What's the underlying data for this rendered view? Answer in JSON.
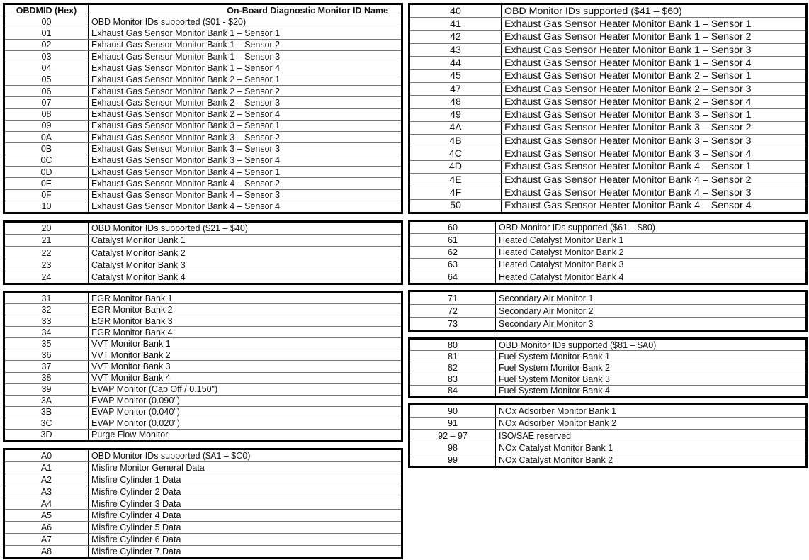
{
  "header": {
    "id_col": "OBDMID (Hex)",
    "name_col": "On-Board Diagnostic Monitor ID Name"
  },
  "tables": [
    {
      "rows": [
        [
          "00",
          "OBD Monitor IDs supported ($01 - $20)"
        ],
        [
          "01",
          "Exhaust Gas Sensor Monitor Bank 1 – Sensor 1"
        ],
        [
          "02",
          "Exhaust Gas Sensor Monitor Bank 1 – Sensor 2"
        ],
        [
          "03",
          "Exhaust Gas Sensor Monitor Bank 1 – Sensor 3"
        ],
        [
          "04",
          "Exhaust Gas Sensor Monitor Bank 1 – Sensor 4"
        ],
        [
          "05",
          "Exhaust Gas Sensor Monitor Bank 2 – Sensor 1"
        ],
        [
          "06",
          "Exhaust Gas Sensor Monitor Bank 2 – Sensor 2"
        ],
        [
          "07",
          "Exhaust Gas Sensor Monitor Bank 2 – Sensor 3"
        ],
        [
          "08",
          "Exhaust Gas Sensor Monitor Bank 2 – Sensor 4"
        ],
        [
          "09",
          "Exhaust Gas Sensor Monitor Bank 3 – Sensor 1"
        ],
        [
          "0A",
          "Exhaust Gas Sensor Monitor Bank 3 – Sensor 2"
        ],
        [
          "0B",
          "Exhaust Gas Sensor Monitor Bank 3 – Sensor 3"
        ],
        [
          "0C",
          "Exhaust Gas Sensor Monitor Bank 3 – Sensor 4"
        ],
        [
          "0D",
          "Exhaust Gas Sensor Monitor Bank 4 – Sensor 1"
        ],
        [
          "0E",
          "Exhaust Gas Sensor Monitor Bank 4 – Sensor 2"
        ],
        [
          "0F",
          "Exhaust Gas Sensor Monitor Bank 4 – Sensor 3"
        ],
        [
          "10",
          "Exhaust Gas Sensor Monitor Bank 4 – Sensor 4"
        ]
      ]
    },
    {
      "rows": [
        [
          "20",
          "OBD Monitor IDs supported ($21 – $40)"
        ],
        [
          "21",
          "Catalyst Monitor Bank 1"
        ],
        [
          "22",
          "Catalyst Monitor Bank 2"
        ],
        [
          "23",
          "Catalyst Monitor Bank 3"
        ],
        [
          "24",
          "Catalyst Monitor Bank 4"
        ]
      ]
    },
    {
      "rows": [
        [
          "31",
          "EGR Monitor Bank 1"
        ],
        [
          "32",
          "EGR Monitor Bank 2"
        ],
        [
          "33",
          "EGR Monitor Bank 3"
        ],
        [
          "34",
          "EGR Monitor Bank 4"
        ],
        [
          "35",
          "VVT Monitor Bank 1"
        ],
        [
          "36",
          "VVT Monitor Bank 2"
        ],
        [
          "37",
          "VVT Monitor Bank 3"
        ],
        [
          "38",
          "VVT Monitor Bank 4"
        ],
        [
          "39",
          "EVAP Monitor (Cap Off / 0.150\")"
        ],
        [
          "3A",
          "EVAP Monitor (0.090\")"
        ],
        [
          "3B",
          "EVAP Monitor (0.040\")"
        ],
        [
          "3C",
          "EVAP Monitor (0.020\")"
        ],
        [
          "3D",
          "Purge Flow Monitor"
        ]
      ]
    },
    {
      "rows": [
        [
          "A0",
          "OBD Monitor IDs supported ($A1 – $C0)"
        ],
        [
          "A1",
          "Misfire Monitor General Data"
        ],
        [
          "A2",
          "Misfire Cylinder 1 Data"
        ],
        [
          "A3",
          "Misfire Cylinder 2 Data"
        ],
        [
          "A4",
          "Misfire Cylinder 3 Data"
        ],
        [
          "A5",
          "Misfire Cylinder 4 Data"
        ],
        [
          "A6",
          "Misfire Cylinder 5 Data"
        ],
        [
          "A7",
          "Misfire Cylinder 6 Data"
        ],
        [
          "A8",
          "Misfire Cylinder 7 Data"
        ]
      ]
    },
    {
      "rows": [
        [
          "40",
          "OBD Monitor IDs supported ($41 – $60)"
        ],
        [
          "41",
          "Exhaust Gas Sensor Heater Monitor Bank 1 – Sensor 1"
        ],
        [
          "42",
          "Exhaust Gas Sensor Heater Monitor Bank 1 – Sensor 2"
        ],
        [
          "43",
          "Exhaust Gas Sensor Heater Monitor Bank 1 – Sensor 3"
        ],
        [
          "44",
          "Exhaust Gas Sensor Heater Monitor Bank 1 – Sensor 4"
        ],
        [
          "45",
          "Exhaust Gas Sensor Heater Monitor Bank 2 – Sensor 1"
        ],
        [
          "47",
          "Exhaust Gas Sensor Heater Monitor Bank 2 – Sensor 3"
        ],
        [
          "48",
          "Exhaust Gas Sensor Heater Monitor Bank 2 – Sensor 4"
        ],
        [
          "49",
          "Exhaust Gas Sensor Heater Monitor Bank 3 – Sensor 1"
        ],
        [
          "4A",
          "Exhaust Gas Sensor Heater Monitor Bank 3 – Sensor 2"
        ],
        [
          "4B",
          "Exhaust Gas Sensor Heater Monitor Bank 3 – Sensor 3"
        ],
        [
          "4C",
          "Exhaust Gas Sensor Heater Monitor Bank 3 – Sensor 4"
        ],
        [
          "4D",
          "Exhaust Gas Sensor Heater Monitor Bank 4 – Sensor 1"
        ],
        [
          "4E",
          "Exhaust Gas Sensor Heater Monitor Bank 4 – Sensor 2"
        ],
        [
          "4F",
          "Exhaust Gas Sensor Heater Monitor Bank 4 – Sensor 3"
        ],
        [
          "50",
          "Exhaust Gas Sensor Heater Monitor Bank 4 – Sensor 4"
        ]
      ]
    },
    {
      "rows": [
        [
          "60",
          "OBD Monitor IDs supported ($61 – $80)"
        ],
        [
          "61",
          "Heated Catalyst Monitor Bank 1"
        ],
        [
          "62",
          "Heated Catalyst Monitor Bank 2"
        ],
        [
          "63",
          "Heated Catalyst Monitor Bank 3"
        ],
        [
          "64",
          "Heated Catalyst Monitor Bank 4"
        ]
      ]
    },
    {
      "rows": [
        [
          "71",
          "Secondary Air Monitor 1"
        ],
        [
          "72",
          "Secondary Air Monitor 2"
        ],
        [
          "73",
          "Secondary Air Monitor 3"
        ]
      ]
    },
    {
      "rows": [
        [
          "80",
          "OBD Monitor IDs supported ($81 – $A0)"
        ],
        [
          "81",
          "Fuel System Monitor Bank 1"
        ],
        [
          "82",
          "Fuel System Monitor Bank 2"
        ],
        [
          "83",
          "Fuel System Monitor Bank 3"
        ],
        [
          "84",
          "Fuel System Monitor Bank 4"
        ]
      ]
    },
    {
      "rows": [
        [
          "90",
          "NOx Adsorber Monitor Bank 1"
        ],
        [
          "91",
          "NOx Adsorber Monitor Bank 2"
        ],
        [
          "92 – 97",
          "ISO/SAE reserved"
        ],
        [
          "98",
          "NOx Catalyst Monitor Bank 1"
        ],
        [
          "99",
          "NOx Catalyst Monitor Bank 2"
        ]
      ]
    }
  ]
}
